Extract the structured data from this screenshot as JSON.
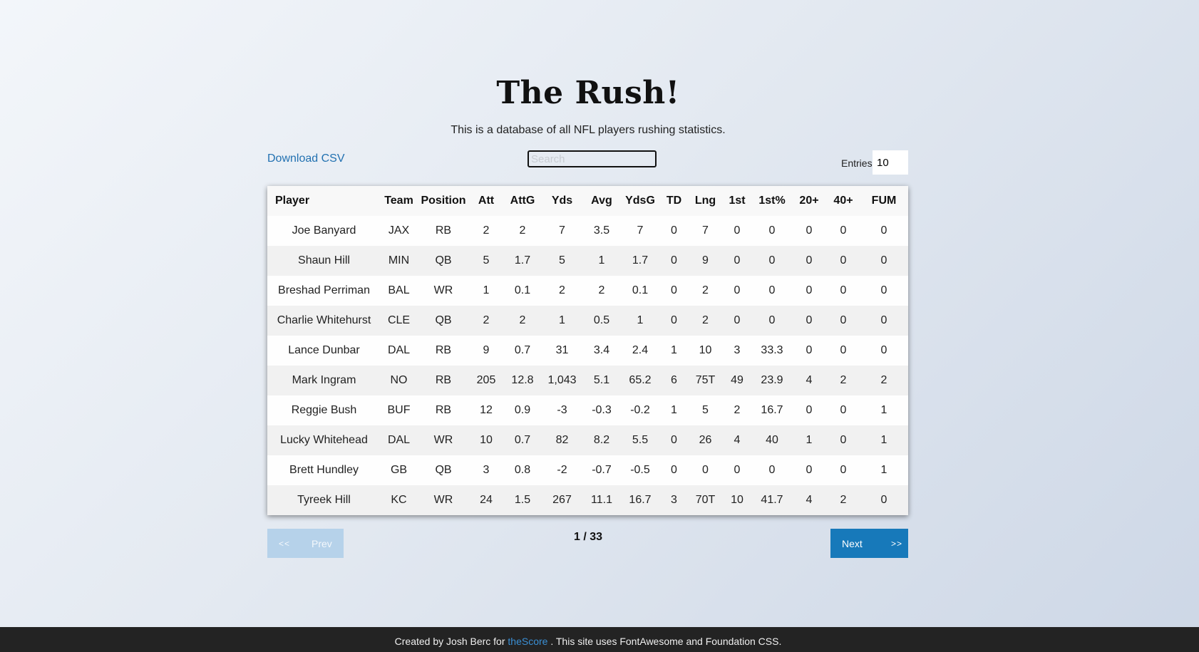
{
  "header": {
    "title": "The Rush!",
    "subtitle": "This is a database of all NFL players rushing statistics."
  },
  "controls": {
    "download_label": "Download CSV",
    "search_placeholder": "Search",
    "search_value": "",
    "entries_label": "Entries",
    "entries_value": "10"
  },
  "table": {
    "columns": [
      "Player",
      "Team",
      "Position",
      "Att",
      "AttG",
      "Yds",
      "Avg",
      "YdsG",
      "TD",
      "Lng",
      "1st",
      "1st%",
      "20+",
      "40+",
      "FUM"
    ],
    "rows": [
      [
        "Joe Banyard",
        "JAX",
        "RB",
        "2",
        "2",
        "7",
        "3.5",
        "7",
        "0",
        "7",
        "0",
        "0",
        "0",
        "0",
        "0"
      ],
      [
        "Shaun Hill",
        "MIN",
        "QB",
        "5",
        "1.7",
        "5",
        "1",
        "1.7",
        "0",
        "9",
        "0",
        "0",
        "0",
        "0",
        "0"
      ],
      [
        "Breshad Perriman",
        "BAL",
        "WR",
        "1",
        "0.1",
        "2",
        "2",
        "0.1",
        "0",
        "2",
        "0",
        "0",
        "0",
        "0",
        "0"
      ],
      [
        "Charlie Whitehurst",
        "CLE",
        "QB",
        "2",
        "2",
        "1",
        "0.5",
        "1",
        "0",
        "2",
        "0",
        "0",
        "0",
        "0",
        "0"
      ],
      [
        "Lance Dunbar",
        "DAL",
        "RB",
        "9",
        "0.7",
        "31",
        "3.4",
        "2.4",
        "1",
        "10",
        "3",
        "33.3",
        "0",
        "0",
        "0"
      ],
      [
        "Mark Ingram",
        "NO",
        "RB",
        "205",
        "12.8",
        "1,043",
        "5.1",
        "65.2",
        "6",
        "75T",
        "49",
        "23.9",
        "4",
        "2",
        "2"
      ],
      [
        "Reggie Bush",
        "BUF",
        "RB",
        "12",
        "0.9",
        "-3",
        "-0.3",
        "-0.2",
        "1",
        "5",
        "2",
        "16.7",
        "0",
        "0",
        "1"
      ],
      [
        "Lucky Whitehead",
        "DAL",
        "WR",
        "10",
        "0.7",
        "82",
        "8.2",
        "5.5",
        "0",
        "26",
        "4",
        "40",
        "1",
        "0",
        "1"
      ],
      [
        "Brett Hundley",
        "GB",
        "QB",
        "3",
        "0.8",
        "-2",
        "-0.7",
        "-0.5",
        "0",
        "0",
        "0",
        "0",
        "0",
        "0",
        "1"
      ],
      [
        "Tyreek Hill",
        "KC",
        "WR",
        "24",
        "1.5",
        "267",
        "11.1",
        "16.7",
        "3",
        "70T",
        "10",
        "41.7",
        "4",
        "2",
        "0"
      ]
    ]
  },
  "pagination": {
    "first_label": "<<",
    "prev_label": "Prev",
    "next_label": "Next",
    "last_label": ">>",
    "page_text": "1 / 33"
  },
  "footer": {
    "prefix": "Created by Josh Berc for",
    "link_text": "theScore",
    "suffix": ". This site uses FontAwesome and Foundation CSS."
  },
  "colors": {
    "accent": "#1779ba",
    "link": "#2271b1",
    "footer_bg": "#232323"
  }
}
